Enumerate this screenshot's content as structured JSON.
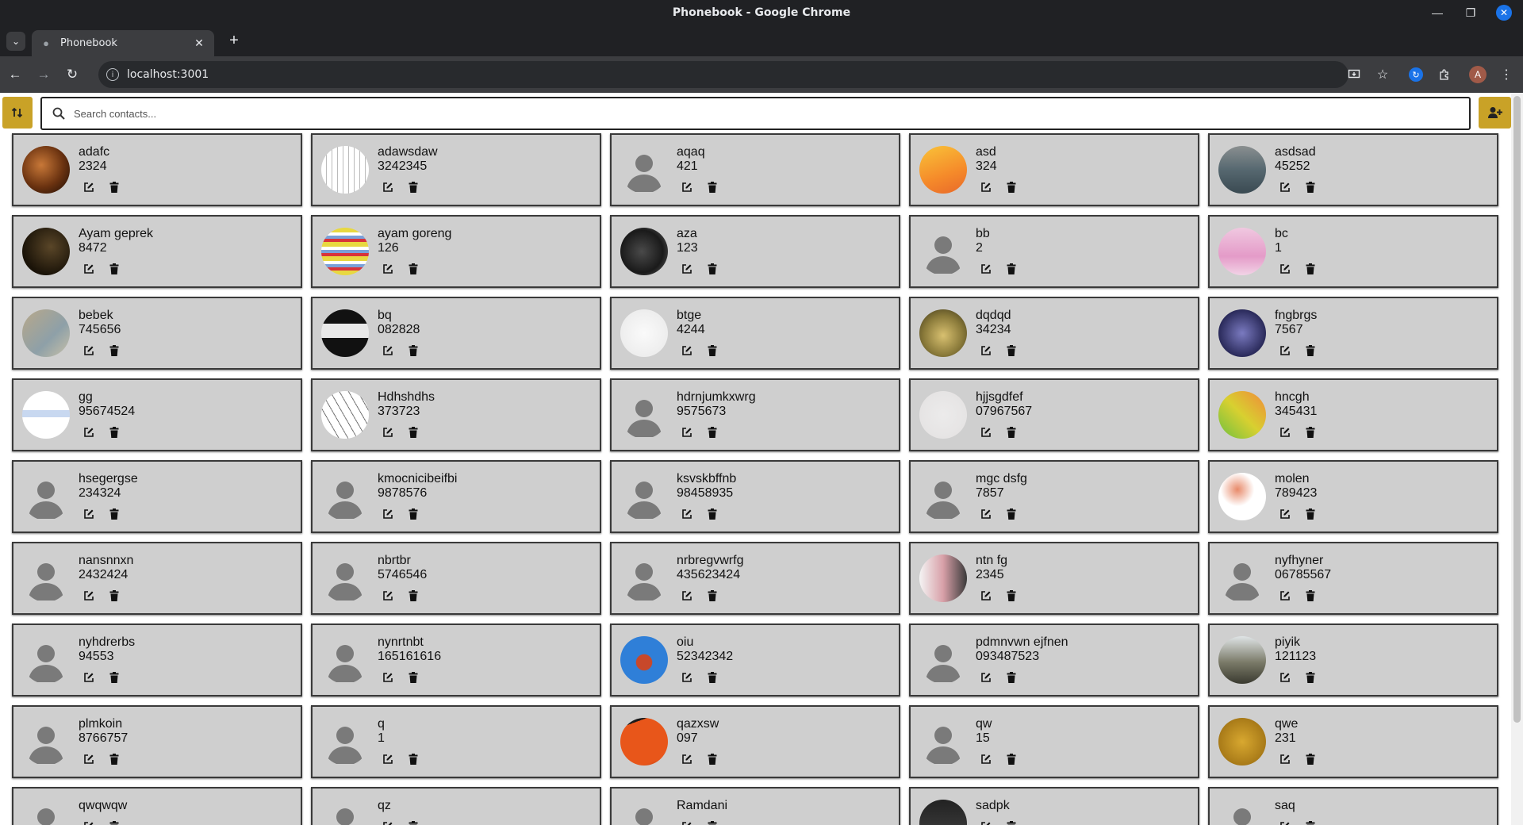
{
  "window": {
    "title": "Phonebook - Google Chrome"
  },
  "tab": {
    "title": "Phonebook"
  },
  "address": {
    "url": "localhost:3001"
  },
  "search": {
    "placeholder": "Search contacts..."
  },
  "colors": {
    "accent": "#c9a227",
    "card": "#cfcfcf"
  },
  "contacts": [
    {
      "name": "adafc",
      "phone": "2324",
      "photo": "radial-gradient(circle at 40% 40%,#c87838,#6a3210 55%,#1a0c06)"
    },
    {
      "name": "adawsdaw",
      "phone": "3242345",
      "photo": "repeating-linear-gradient(90deg,#fff 0 6px,#bbb 6px 7px),#fff"
    },
    {
      "name": "aqaq",
      "phone": "421",
      "photo": "default"
    },
    {
      "name": "asd",
      "phone": "324",
      "photo": "linear-gradient(160deg,#f9c339,#f58a2a 60%,#e8692a)"
    },
    {
      "name": "asdsad",
      "phone": "45252",
      "photo": "linear-gradient(180deg,#8a8f90,#566870 50%,#3a4a52)"
    },
    {
      "name": "Ayam geprek",
      "phone": "8472",
      "photo": "radial-gradient(circle at 60% 40%,#5a4628,#1a1308 70%)"
    },
    {
      "name": "ayam goreng",
      "phone": "126",
      "photo": "repeating-linear-gradient(0deg,#e8d840 0 6px,#d8333a 6px 10px,#7aa0d8 10px 14px,#fff 14px 18px)"
    },
    {
      "name": "aza",
      "phone": "123",
      "photo": "radial-gradient(circle at 45% 50%,#4a4a4a,#1a1a1a 60%,#6a6a6a)"
    },
    {
      "name": "bb",
      "phone": "2",
      "photo": "default"
    },
    {
      "name": "bc",
      "phone": "1",
      "photo": "linear-gradient(180deg,#f0c8e0,#e49bc8 60%,#f2d3e6)"
    },
    {
      "name": "bebek",
      "phone": "745656",
      "photo": "linear-gradient(135deg,#b8a88a,#8ea0a8 60%,#c8c0a8)"
    },
    {
      "name": "bq",
      "phone": "082828",
      "photo": "linear-gradient(180deg,#111 0 30%,#e8e8e8 30% 60%,#111 60%)"
    },
    {
      "name": "btge",
      "phone": "4244",
      "photo": "radial-gradient(circle,#fafafa,#e8e8e8)"
    },
    {
      "name": "dqdqd",
      "phone": "34234",
      "photo": "radial-gradient(circle at 50% 55%,#d8c070,#8a7a3a 55%,#3a3318)"
    },
    {
      "name": "fngbrgs",
      "phone": "7567",
      "photo": "radial-gradient(circle,#7a7ac0,#2a2a5a 70%)"
    },
    {
      "name": "gg",
      "phone": "95674524",
      "photo": "linear-gradient(180deg,#fff 0 40%,#c8d8f0 40% 55%,#fff 55%)"
    },
    {
      "name": "Hdhshdhs",
      "phone": "373723",
      "photo": "repeating-linear-gradient(60deg,#fff 0 9px,#777 9px 10px)"
    },
    {
      "name": "hdrnjumkxwrg",
      "phone": "9575673",
      "photo": "default"
    },
    {
      "name": "hjjsgdfef",
      "phone": "07967567",
      "photo": "radial-gradient(circle,#ecebeb,#e3e1e1)"
    },
    {
      "name": "hncgh",
      "phone": "345431",
      "photo": "linear-gradient(45deg,#6ec040,#d8d030 50%,#f08a3a)"
    },
    {
      "name": "hsegergse",
      "phone": "234324",
      "photo": "default"
    },
    {
      "name": "kmocnicibeifbi",
      "phone": "9878576",
      "photo": "default"
    },
    {
      "name": "ksvskbffnb",
      "phone": "98458935",
      "photo": "default"
    },
    {
      "name": "mgc dsfg",
      "phone": "7857",
      "photo": "default"
    },
    {
      "name": "molen",
      "phone": "789423",
      "photo": "radial-gradient(circle at 40% 35%,#e88a6a,#fff 40%)"
    },
    {
      "name": "nansnnxn",
      "phone": "2432424",
      "photo": "default"
    },
    {
      "name": "nbrtbr",
      "phone": "5746546",
      "photo": "default"
    },
    {
      "name": "nrbregvwrfg",
      "phone": "435623424",
      "photo": "default"
    },
    {
      "name": "ntn fg",
      "phone": "2345",
      "photo": "linear-gradient(90deg,#f4f4f4,#d8a0a8 50%,#3a3a3a)"
    },
    {
      "name": "nyfhyner",
      "phone": "06785567",
      "photo": "default"
    },
    {
      "name": "nyhdrerbs",
      "phone": "94553",
      "photo": "default"
    },
    {
      "name": "nynrtnbt",
      "phone": "165161616",
      "photo": "default"
    },
    {
      "name": "oiu",
      "phone": "52342342",
      "photo": "radial-gradient(circle at 50% 55%,#c8482a 0 22%,#2f7fd8 24%)"
    },
    {
      "name": "pdmnvwn ejfnen",
      "phone": "093487523",
      "photo": "default"
    },
    {
      "name": "piyik",
      "phone": "121123",
      "photo": "linear-gradient(180deg,#dfe4e6,#7a7a68 55%,#3a3a30)"
    },
    {
      "name": "plmkoin",
      "phone": "8766757",
      "photo": "default"
    },
    {
      "name": "q",
      "phone": "1",
      "photo": "default"
    },
    {
      "name": "qazxsw",
      "phone": "097",
      "photo": "linear-gradient(160deg,#1a1a1a 0 15%,#e8561a 15% 85%,#b83a10)"
    },
    {
      "name": "qw",
      "phone": "15",
      "photo": "default"
    },
    {
      "name": "qwe",
      "phone": "231",
      "photo": "radial-gradient(circle,#d8a830,#a87a18 70%)"
    },
    {
      "name": "qwqwqw",
      "phone": "",
      "photo": "default"
    },
    {
      "name": "qz",
      "phone": "",
      "photo": "default"
    },
    {
      "name": "Ramdani",
      "phone": "",
      "photo": "default"
    },
    {
      "name": "sadpk",
      "phone": "",
      "photo": "linear-gradient(180deg,#222,#444)"
    },
    {
      "name": "saq",
      "phone": "",
      "photo": "default"
    }
  ]
}
